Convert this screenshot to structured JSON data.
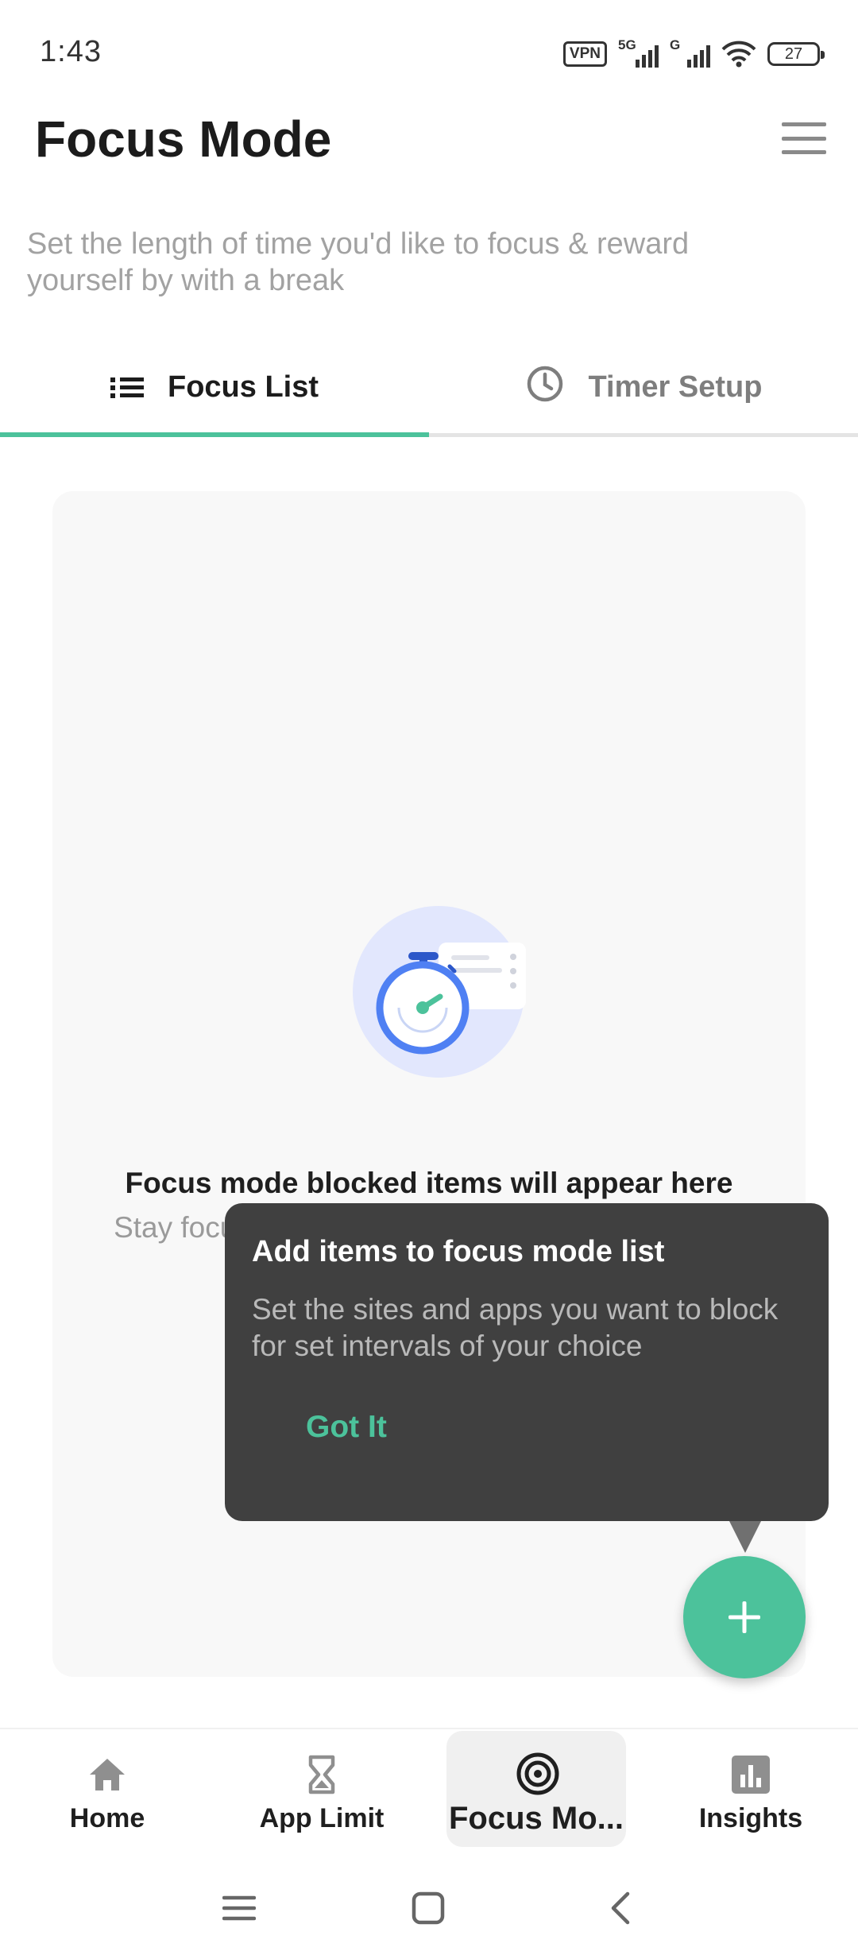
{
  "status_bar": {
    "time": "1:43",
    "vpn_label": "VPN",
    "network_1": "5G",
    "network_2": "G",
    "battery": "27"
  },
  "header": {
    "title": "Focus Mode",
    "menu_icon": "hamburger-menu-icon",
    "subtitle": "Set the length of time you'd like to focus & reward yourself by with a break"
  },
  "tabs": [
    {
      "label": "Focus List",
      "icon": "list-icon",
      "active": true
    },
    {
      "label": "Timer Setup",
      "icon": "clock-icon",
      "active": false
    }
  ],
  "empty_state": {
    "illustration": "stopwatch-illustration",
    "title": "Focus mode blocked items will appear here",
    "description": "Stay focused on a task. Add sites, apps, or more now."
  },
  "tooltip": {
    "title": "Add items to focus mode list",
    "body": "Set the sites and apps you want to block for set intervals of your choice",
    "action": "Got It"
  },
  "fab": {
    "icon": "plus-icon"
  },
  "bottom_nav": [
    {
      "label": "Home",
      "icon": "home-icon",
      "active": false
    },
    {
      "label": "App Limit",
      "icon": "hourglass-icon",
      "active": false
    },
    {
      "label": "Focus Mo...",
      "icon": "target-icon",
      "active": true
    },
    {
      "label": "Insights",
      "icon": "bar-chart-icon",
      "active": false
    }
  ],
  "colors": {
    "accent": "#4cc29b",
    "tooltip_bg": "#404040",
    "card_bg": "#f8f8f8"
  }
}
